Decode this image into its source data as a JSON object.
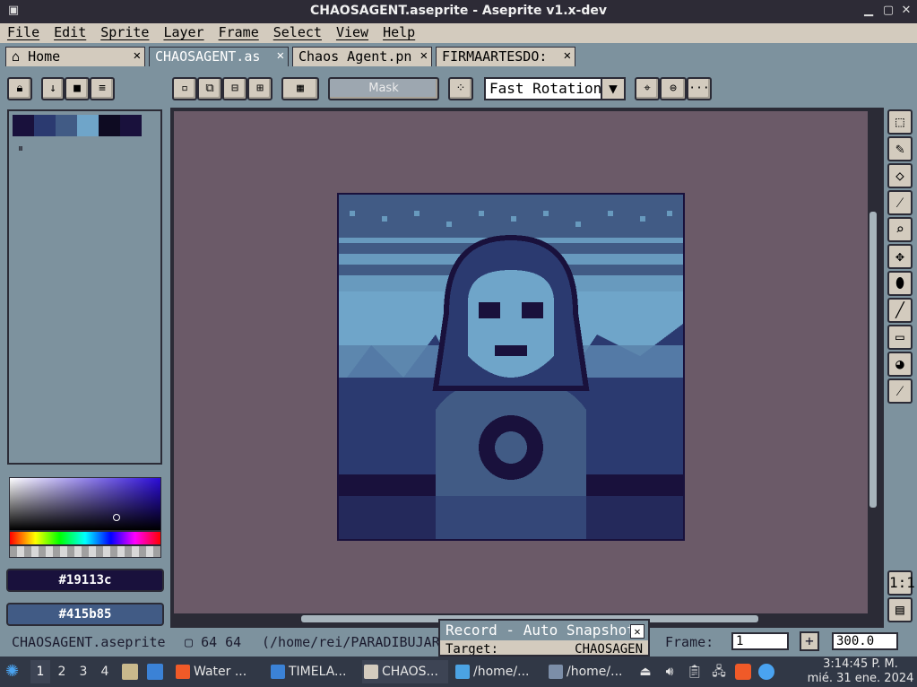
{
  "window": {
    "title": "CHAOSAGENT.aseprite - Aseprite v1.x-dev"
  },
  "menu": [
    "File",
    "Edit",
    "Sprite",
    "Layer",
    "Frame",
    "Select",
    "View",
    "Help"
  ],
  "tabs": [
    {
      "label": "Home",
      "icon": "home-icon"
    },
    {
      "label": "CHAOSAGENT.as",
      "active": true
    },
    {
      "label": "Chaos Agent.pn"
    },
    {
      "label": "FIRMAARTESDO:"
    }
  ],
  "toolbar": {
    "mask_label": "Mask",
    "rotation_value": "Fast Rotation"
  },
  "palette": {
    "colors": [
      "#19113c",
      "#2b3a70",
      "#415b85",
      "#6fa5c9",
      "#0e0b22",
      "#19113c"
    ]
  },
  "colors": {
    "foreground": "#19113c",
    "background": "#415b85",
    "accent": "#7d929e",
    "panel": "#d3cbbe"
  },
  "status": {
    "file": "CHAOSAGENT.aseprite",
    "size": "64 64",
    "path": "(/home/rei/PARADIBUJAR",
    "frame_label": "Frame:",
    "frame_value": "1",
    "add_symbol": "+",
    "zoom_value": "300.0"
  },
  "record_popup": {
    "title": "Record - Auto Snapshot",
    "target_label": "Target:",
    "target_value": "CHAOSAGEN"
  },
  "taskbar": {
    "workspaces": [
      "1",
      "2",
      "3",
      "4"
    ],
    "apps": [
      {
        "label": "Water ...",
        "color": "#f05a28"
      },
      {
        "label": "TIMELA...",
        "color": "#3b82d6"
      },
      {
        "label": "CHAOS...",
        "color": "#d3cbbe"
      },
      {
        "label": "/home/...",
        "color": "#4ba3e3"
      },
      {
        "label": "/home/...",
        "color": "#7c8ea8"
      }
    ],
    "clock_time": "3:14:45 P. M.",
    "clock_date": "mié. 31 ene. 2024"
  }
}
